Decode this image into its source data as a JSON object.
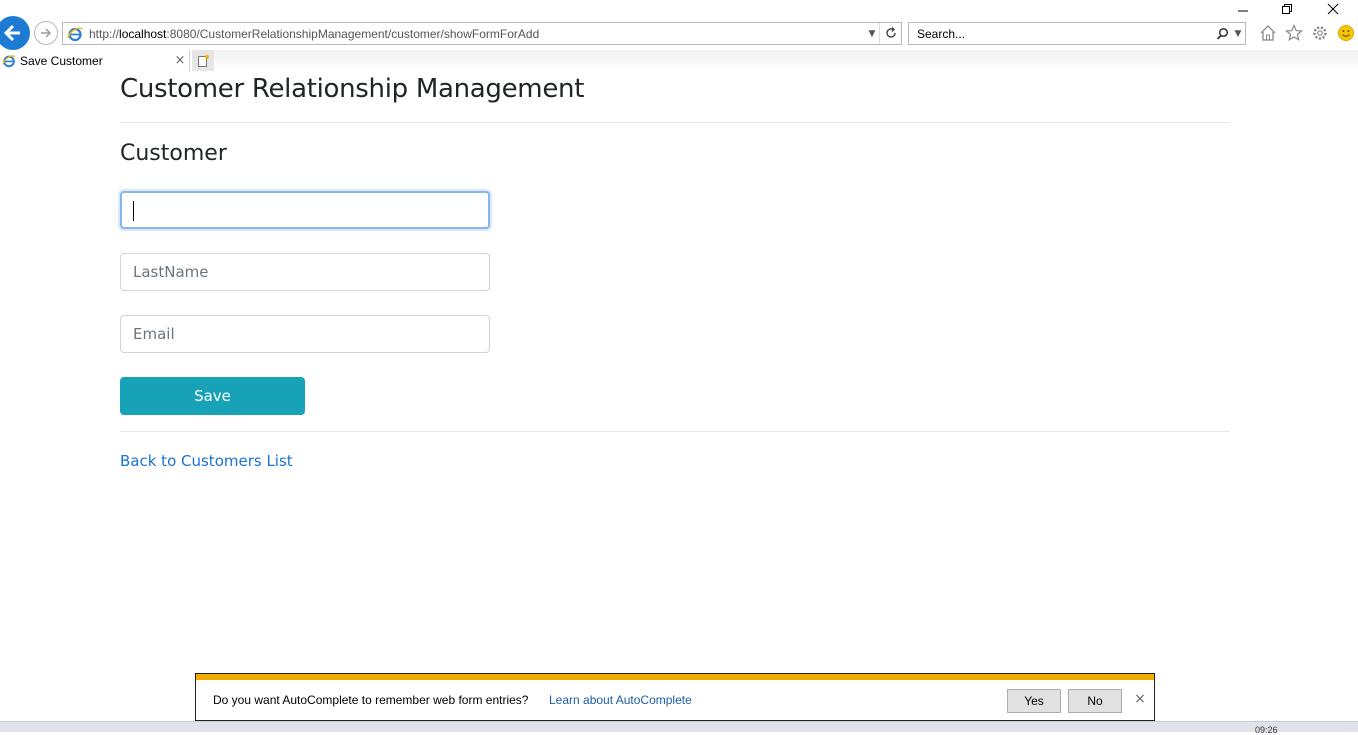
{
  "browser": {
    "address_prefix": "http://",
    "address_host": "localhost",
    "address_rest": ":8080/CustomerRelationshipManagement/customer/showFormForAdd",
    "search_placeholder": "Search...",
    "tab_title": "Save Customer",
    "tab_close": "×"
  },
  "page": {
    "title": "Customer Relationship Management",
    "section_title": "Customer",
    "first_name_value": "",
    "last_name_placeholder": "LastName",
    "email_placeholder": "Email",
    "save_label": "Save",
    "back_link": "Back to Customers List"
  },
  "autocomplete_bar": {
    "message": "Do you want AutoComplete to remember web form entries?",
    "learn_link": "Learn about AutoComplete",
    "yes_label": "Yes",
    "no_label": "No",
    "close": "×"
  },
  "taskbar": {
    "time": "09:26"
  },
  "colors": {
    "accent_button": "#17a2b8",
    "link": "#1a73d2",
    "notify_stripe": "#f0ad00",
    "ie_blue": "#1e7bd3"
  }
}
